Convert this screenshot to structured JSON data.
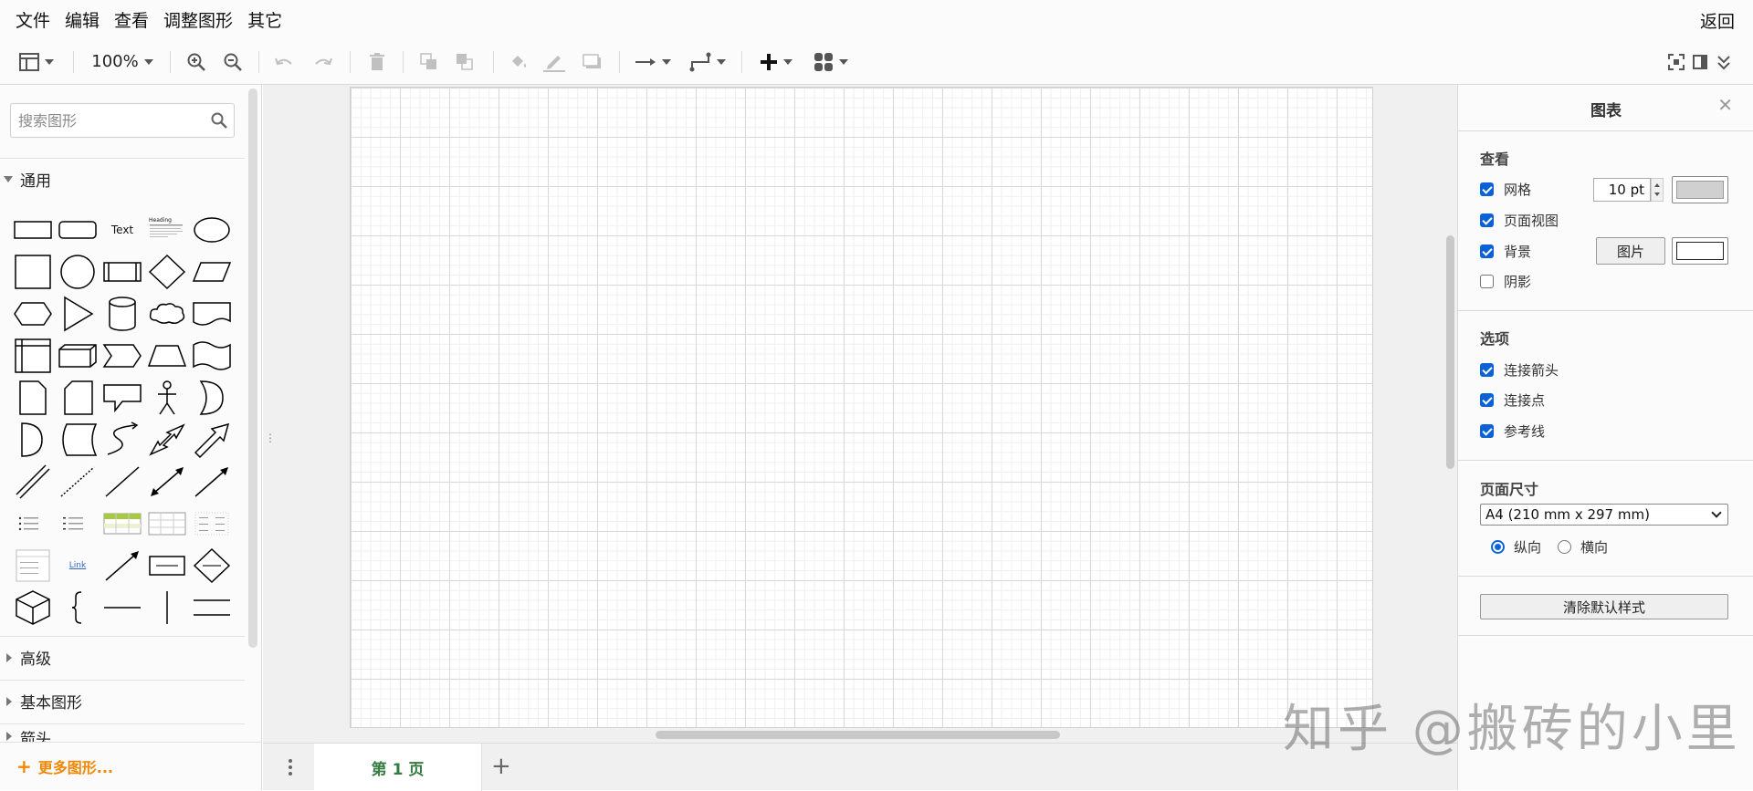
{
  "menu": {
    "items": [
      "文件",
      "编辑",
      "查看",
      "调整图形",
      "其它"
    ],
    "back": "返回"
  },
  "toolbar": {
    "zoom": "100%",
    "icons": [
      "layout-icon",
      "zoom-in-icon",
      "zoom-out-icon",
      "undo-icon",
      "redo-icon",
      "delete-icon",
      "to-front-icon",
      "to-back-icon",
      "fill-color-icon",
      "line-color-icon",
      "shadow-icon",
      "connection-icon",
      "waypoints-icon",
      "insert-icon",
      "table-icon",
      "fullscreen-icon",
      "format-panel-icon",
      "collapse-icon"
    ]
  },
  "sidebar": {
    "search_placeholder": "搜索图形",
    "categories": {
      "general": "通用",
      "advanced": "高级",
      "basic": "基本图形",
      "arrows": "箭头"
    },
    "shape_labels": {
      "text": "Text",
      "heading": "Heading",
      "link": "Link"
    },
    "more_shapes": "更多图形..."
  },
  "page_tabs": {
    "current": "第 1 页"
  },
  "format_panel": {
    "title": "图表",
    "view_section": "查看",
    "grid": {
      "label": "网格",
      "checked": true,
      "size": "10 pt",
      "color": "#d0d0d0"
    },
    "page_view": {
      "label": "页面视图",
      "checked": true
    },
    "background": {
      "label": "背景",
      "checked": true,
      "image_button": "图片",
      "color": "#ffffff"
    },
    "shadow": {
      "label": "阴影",
      "checked": false
    },
    "options_section": "选项",
    "connection_arrows": {
      "label": "连接箭头",
      "checked": true
    },
    "connection_points": {
      "label": "连接点",
      "checked": true
    },
    "guides": {
      "label": "参考线",
      "checked": true
    },
    "paper_section": "页面尺寸",
    "paper_size": "A4 (210 mm x 297 mm)",
    "portrait": "纵向",
    "landscape": "横向",
    "orientation": "portrait",
    "clear_style": "清除默认样式"
  },
  "watermark": "知乎 @搬砖的小里",
  "colors": {
    "accent": "#0b62d6",
    "more_shapes": "#f08705",
    "page_tab": "#357b42"
  }
}
